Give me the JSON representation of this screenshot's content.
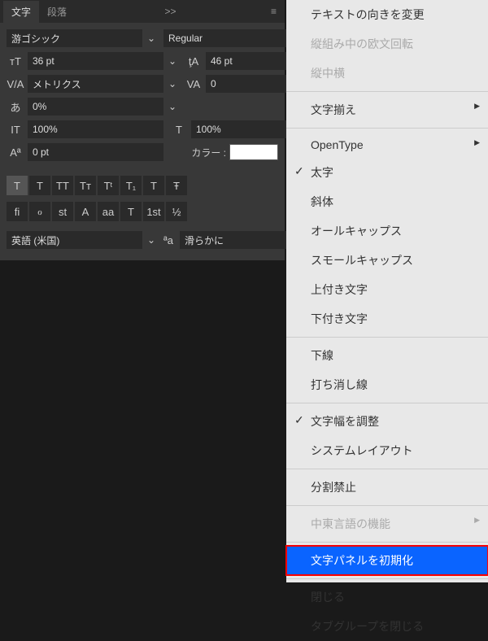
{
  "tabs": {
    "character": "文字",
    "paragraph": "段落",
    "more": ">>",
    "menu": "≡"
  },
  "font": {
    "family": "游ゴシック",
    "style": "Regular"
  },
  "size": {
    "icon": "тT",
    "value": "36 pt"
  },
  "leading": {
    "icon": "ţA",
    "value": "46 pt"
  },
  "kerning": {
    "icon": "V/A",
    "value": "メトリクス"
  },
  "tracking": {
    "icon": "VA",
    "value": "0"
  },
  "tsume": {
    "icon": "あ",
    "value": "0%"
  },
  "vscale": {
    "icon": "IT",
    "value": "100%"
  },
  "hscale": {
    "icon": "T",
    "value": "100%"
  },
  "baseline": {
    "icon": "Aª",
    "value": "0 pt"
  },
  "colorLabel": "カラー :",
  "styleBtns": [
    "T",
    "T",
    "TT",
    "Tт",
    "Tᵗ",
    "T₁",
    "T",
    "Ŧ"
  ],
  "otBtns": [
    "fi",
    "ℴ",
    "st",
    "A",
    "aa",
    "T",
    "1st",
    "½"
  ],
  "lang": "英語 (米国)",
  "aaIcon": "ªa",
  "antialias": "滑らかに",
  "menuItems": [
    {
      "t": "テキストの向きを変更"
    },
    {
      "t": "縦組み中の欧文回転",
      "d": true
    },
    {
      "t": "縦中横",
      "d": true
    },
    {
      "sep": true
    },
    {
      "t": "文字揃え",
      "sub": true
    },
    {
      "sep": true
    },
    {
      "t": "OpenType",
      "sub": true
    },
    {
      "t": "太字",
      "chk": true
    },
    {
      "t": "斜体"
    },
    {
      "t": "オールキャップス"
    },
    {
      "t": "スモールキャップス"
    },
    {
      "t": "上付き文字"
    },
    {
      "t": "下付き文字"
    },
    {
      "sep": true
    },
    {
      "t": "下線"
    },
    {
      "t": "打ち消し線"
    },
    {
      "sep": true
    },
    {
      "t": "文字幅を調整",
      "chk": true
    },
    {
      "t": "システムレイアウト"
    },
    {
      "sep": true
    },
    {
      "t": "分割禁止"
    },
    {
      "sep": true
    },
    {
      "t": "中東言語の機能",
      "d": true,
      "sub": true
    },
    {
      "sep": true
    },
    {
      "t": "文字パネルを初期化",
      "sel": true
    },
    {
      "sep": true
    },
    {
      "t": "閉じる"
    },
    {
      "t": "タブグループを閉じる"
    }
  ]
}
